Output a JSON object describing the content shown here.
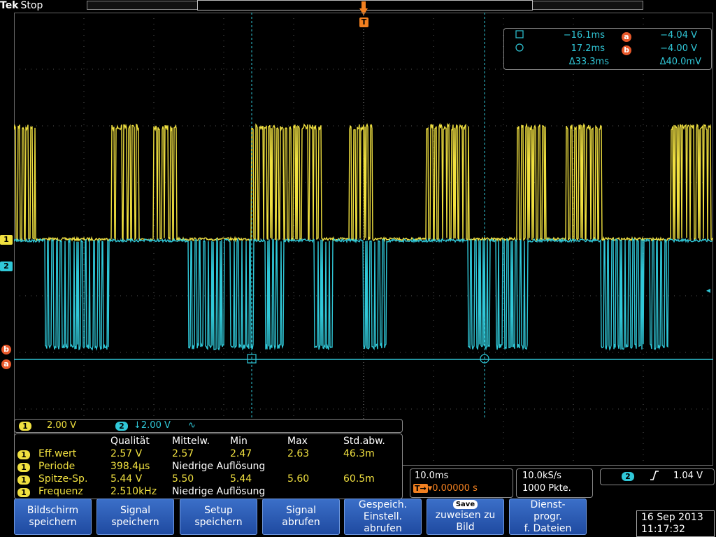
{
  "header": {
    "brand": "Tek",
    "status": "Stop"
  },
  "channel_markers": {
    "ch1": "1",
    "ch2": "2",
    "cursor_a": "a",
    "cursor_b": "b",
    "trigger": "T"
  },
  "cursor_readout": {
    "row1": {
      "time": "−16.1ms",
      "badge": "a",
      "volt": "−4.04 V"
    },
    "row2": {
      "time": "17.2ms",
      "badge": "b",
      "volt": "−4.00 V"
    },
    "row3": {
      "dtime": "Δ33.3ms",
      "dvolt": "Δ40.0mV"
    }
  },
  "scale": {
    "ch1_badge": "1",
    "ch1_value": "2.00 V",
    "ch2_badge": "2",
    "ch2_value": "↓2.00 V",
    "ch2_coupling": "∿"
  },
  "measurements": {
    "headers": [
      "Qualität",
      "Mittelw.",
      "Min",
      "Max",
      "Std.abw."
    ],
    "rows": [
      {
        "badge": "1",
        "name": "Eff.wert",
        "qual": "2.57 V",
        "mean": "2.57",
        "min": "2.47",
        "max": "2.63",
        "std": "46.3m",
        "note": ""
      },
      {
        "badge": "1",
        "name": "Periode",
        "qual": "398.4µs",
        "mean": "",
        "min": "",
        "max": "",
        "std": "",
        "note": "Niedrige Auflösung"
      },
      {
        "badge": "1",
        "name": "Spitze-Sp.",
        "qual": "5.44 V",
        "mean": "5.50",
        "min": "5.44",
        "max": "5.60",
        "std": "60.5m",
        "note": ""
      },
      {
        "badge": "1",
        "name": "Frequenz",
        "qual": "2.510kHz",
        "mean": "",
        "min": "",
        "max": "",
        "std": "",
        "note": "Niedrige Auflösung"
      }
    ]
  },
  "timebase": {
    "scale": "10.0ms",
    "position": "▾0.00000 s",
    "t_label": "T→"
  },
  "acquisition": {
    "rate": "10.0kS/s",
    "points": "1000 Pkte."
  },
  "trigger": {
    "badge": "2",
    "slope": "𝆑",
    "level": "1.04 V"
  },
  "buttons": [
    {
      "l1": "Bildschirm",
      "l2": "speichern"
    },
    {
      "l1": "Signal",
      "l2": "speichern"
    },
    {
      "l1": "Setup",
      "l2": "speichern"
    },
    {
      "l1": "Signal",
      "l2": "abrufen"
    },
    {
      "l1": "Gespeich.",
      "l2": "Einstell.",
      "l3": "abrufen"
    },
    {
      "chip": "Save",
      "l1": "zuweisen zu",
      "l2": "Bild"
    },
    {
      "l1": "Dienst-",
      "l2": "progr.",
      "l3": "f. Dateien"
    }
  ],
  "datetime": {
    "date": "16 Sep 2013",
    "time": "11:17:32"
  },
  "colors": {
    "ch1": "#f0e040",
    "ch2": "#30c8d8",
    "cursor": "#e8582a",
    "button": "#2a5cb8"
  }
}
